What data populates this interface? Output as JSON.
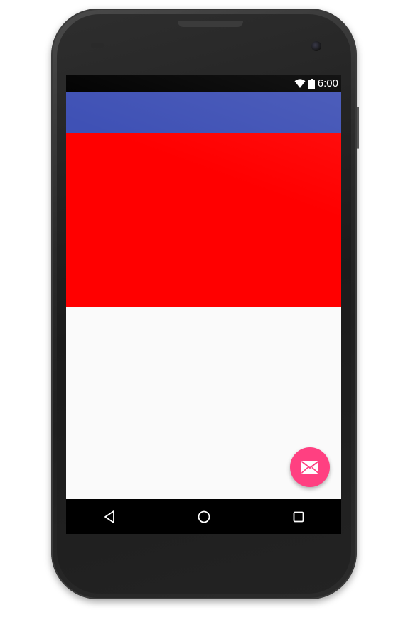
{
  "status_bar": {
    "time": "6:00",
    "wifi_icon": "wifi-icon",
    "battery_icon": "battery-icon"
  },
  "app_bar": {
    "color": "#3f51b5"
  },
  "hero": {
    "color": "#ff0000"
  },
  "content": {
    "background": "#fafafa"
  },
  "fab": {
    "icon": "mail-icon",
    "color": "#ff4081"
  },
  "nav_bar": {
    "back_icon": "back-triangle-icon",
    "home_icon": "home-circle-icon",
    "recents_icon": "recents-square-icon"
  }
}
